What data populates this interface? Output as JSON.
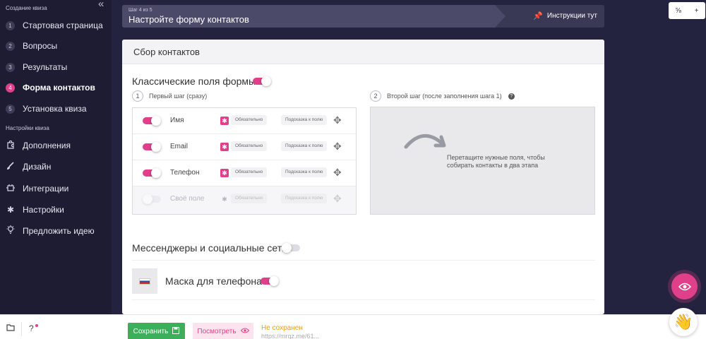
{
  "sidebar": {
    "collapse_icon": "double-chevron-left",
    "section1": "Создание квиза",
    "steps": [
      {
        "num": "1",
        "label": "Стартовая страница"
      },
      {
        "num": "2",
        "label": "Вопросы"
      },
      {
        "num": "3",
        "label": "Результаты"
      },
      {
        "num": "4",
        "label": "Форма контактов"
      },
      {
        "num": "5",
        "label": "Установка квиза"
      }
    ],
    "section2": "Настройки квиза",
    "settings": [
      {
        "icon": "puzzle-icon",
        "label": "Дополнения"
      },
      {
        "icon": "brush-icon",
        "label": "Дизайн"
      },
      {
        "icon": "integration-icon",
        "label": "Интеграции"
      },
      {
        "icon": "gear-icon",
        "label": "Настройки"
      },
      {
        "icon": "lightbulb-icon",
        "label": "Предложить идею"
      }
    ]
  },
  "header": {
    "step_of": "Шаг 4 из 5",
    "title": "Настройте форму контактов",
    "instructions": "Инструкции тут"
  },
  "top_widget": {
    "fraction": "⅝",
    "plus": "+"
  },
  "panel": {
    "title": "Сбор контактов",
    "classic_fields_title": "Классические поля формы",
    "classic_fields_enabled": true,
    "first_step": {
      "num": "1",
      "label": "Первый шаг (сразу)"
    },
    "second_step": {
      "num": "2",
      "label": "Второй шаг (после заполнения шага 1)",
      "help": "?"
    },
    "fields": [
      {
        "name": "Имя",
        "enabled": true,
        "required_label": "Обязательно",
        "hint_label": "Подсказка к полю"
      },
      {
        "name": "Email",
        "enabled": true,
        "required_label": "Обязательно",
        "hint_label": "Подсказка к полю"
      },
      {
        "name": "Телефон",
        "enabled": true,
        "required_label": "Обязательно",
        "hint_label": "Подсказка к полю"
      },
      {
        "name": "Своё поле",
        "enabled": false,
        "required_label": "Обязательно",
        "hint_label": "Подсказка к полю"
      }
    ],
    "drop_hint": "Перетащите нужные поля, чтобы собирать контакты в два этапа",
    "messengers_title": "Мессенджеры и социальные сети",
    "messengers_enabled": false,
    "phone_mask_title": "Маска для телефона",
    "phone_mask_enabled": true
  },
  "bottom": {
    "save_label": "Сохранить",
    "view_label": "Посмотреть",
    "status": "Не сохранен",
    "url": "https://mrqz.me/61..."
  },
  "colors": {
    "accent": "#e0408a",
    "save": "#3cae5c",
    "status": "#f29b1c",
    "sidebar_bg": "#1d1c33"
  }
}
